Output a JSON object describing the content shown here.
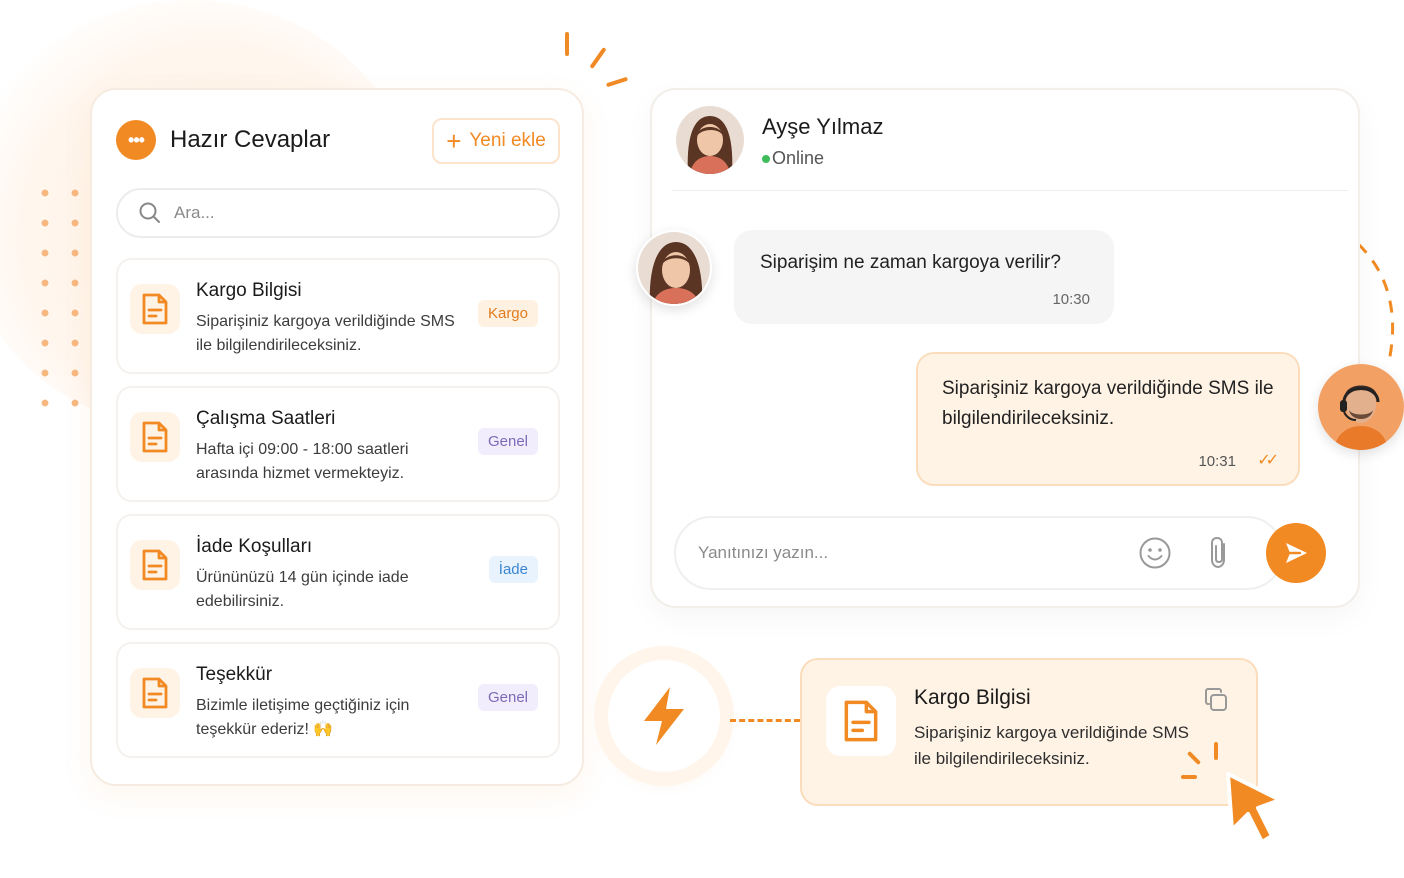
{
  "colors": {
    "accent": "#f28a24",
    "accent_light": "#fff3e5"
  },
  "replies_panel": {
    "title": "Hazır Cevaplar",
    "title_icon": "chat-bubble-dots-icon",
    "new_button": {
      "icon": "plus-icon",
      "label": "Yeni ekle"
    },
    "search": {
      "icon": "search-icon",
      "placeholder": "Ara..."
    },
    "items": [
      {
        "icon": "document-icon",
        "title": "Kargo Bilgisi",
        "text": "Siparişiniz kargoya verildiğinde SMS ile bilgilendirileceksiniz.",
        "tag": "Kargo",
        "tag_color": "orange"
      },
      {
        "icon": "document-icon",
        "title": "Çalışma Saatleri",
        "text": "Hafta içi 09:00 - 18:00 saatleri arasında hizmet vermekteyiz.",
        "tag": "Genel",
        "tag_color": "purple"
      },
      {
        "icon": "document-icon",
        "title": "İade Koşulları",
        "text": "Ürününüzü 14 gün içinde iade edebilirsiniz.",
        "tag": "İade",
        "tag_color": "blue"
      },
      {
        "icon": "document-icon",
        "title": "Teşekkür",
        "text": "Bizimle iletişime geçtiğiniz için teşekkür ederiz! 🙌",
        "tag": "Genel",
        "tag_color": "purple"
      }
    ]
  },
  "chat": {
    "contact_name": "Ayşe Yılmaz",
    "contact_status": "Online",
    "messages": [
      {
        "direction": "incoming",
        "text": "Siparişim ne zaman kargoya verilir?",
        "time": "10:30"
      },
      {
        "direction": "outgoing",
        "text": "Siparişiniz kargoya verildiğinde SMS ile bilgilendirileceksiniz.",
        "time": "10:31",
        "status_icon": "double-check-icon"
      }
    ],
    "reply_placeholder": "Yanıtınızı yazın...",
    "reply_icons": [
      "smiley-icon",
      "paperclip-icon",
      "send-icon"
    ]
  },
  "quick_insert": {
    "icon": "lightning-bolt-icon",
    "card": {
      "icon": "document-icon",
      "title": "Kargo Bilgisi",
      "text": "Siparişiniz kargoya verildiğinde SMS ile bilgilendirileceksiniz.",
      "action_icon": "copy-icon"
    },
    "cursor_icon": "cursor-click-icon"
  }
}
